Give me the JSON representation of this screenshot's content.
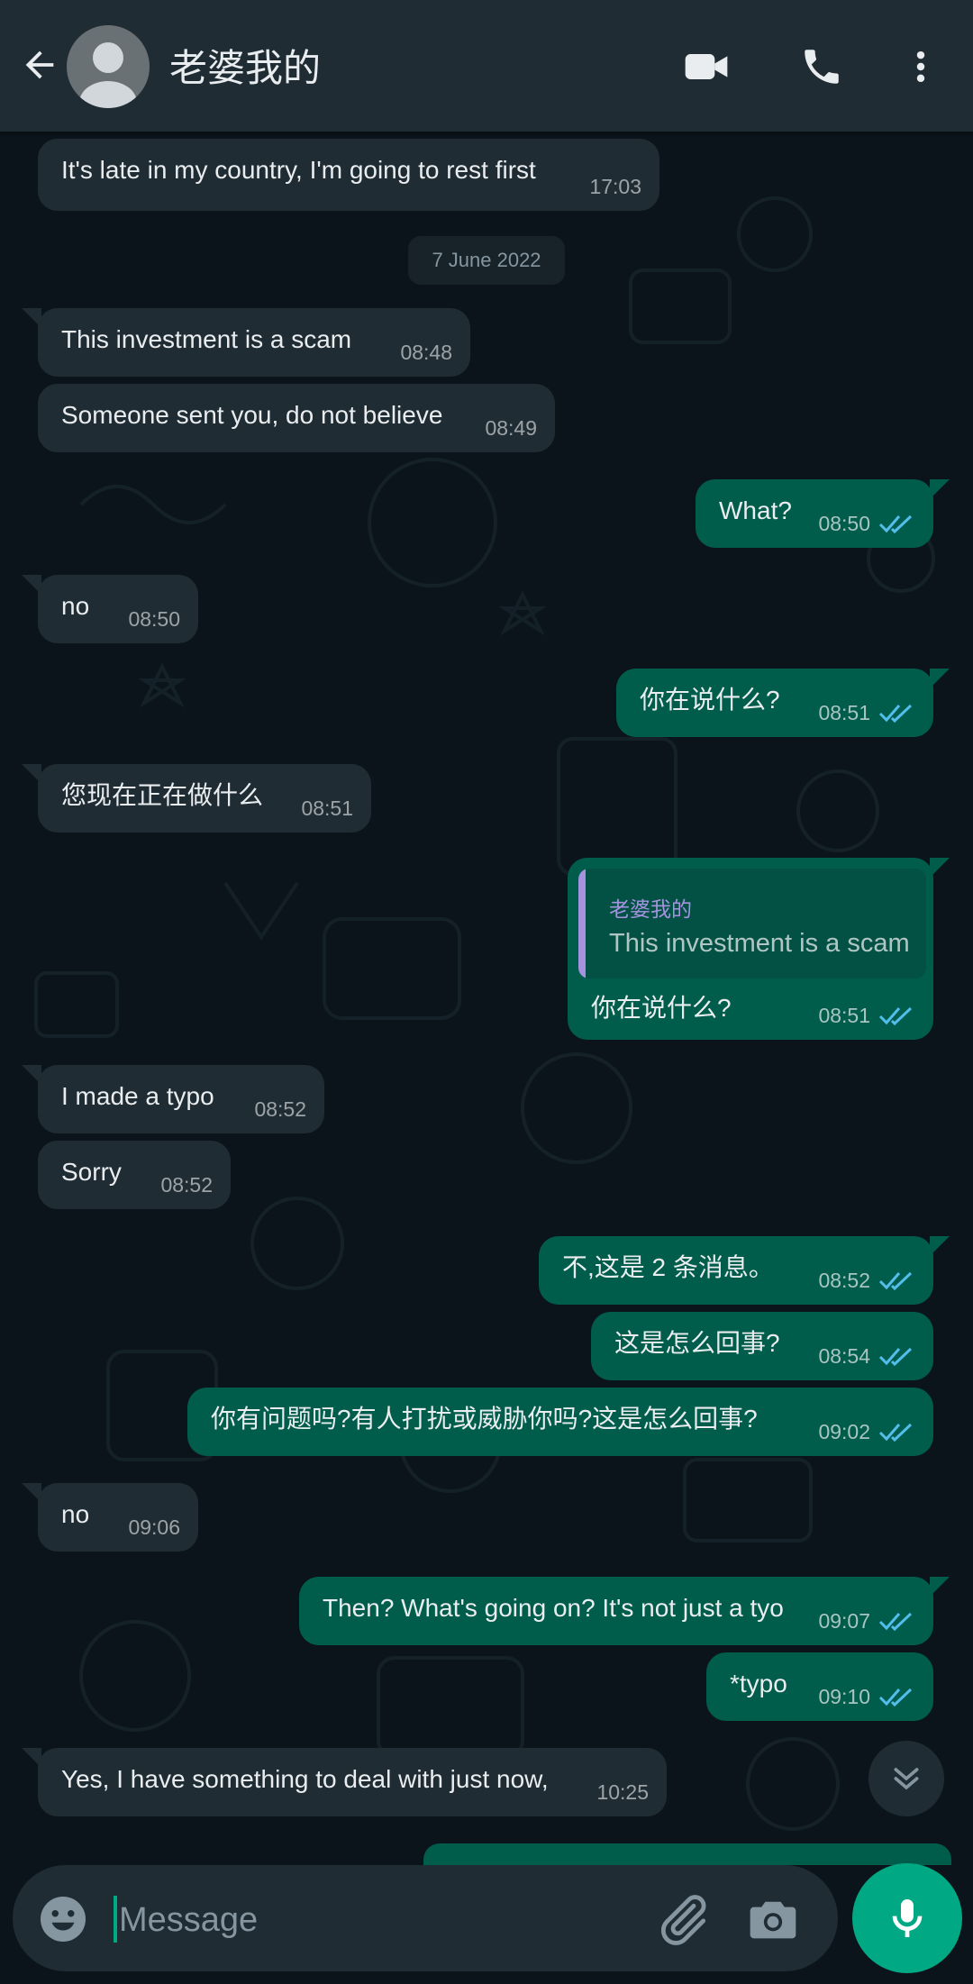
{
  "header": {
    "contact_name": "老婆我的"
  },
  "date_chip": "7 June 2022",
  "messages": [
    {
      "dir": "in",
      "text": "It's late in my country, I'm going to rest first",
      "time": "17:03"
    },
    {
      "dir": "in",
      "text": "This investment is a scam",
      "time": "08:48"
    },
    {
      "dir": "in",
      "text": "Someone sent you, do not believe",
      "time": "08:49"
    },
    {
      "dir": "out",
      "text": "What?",
      "time": "08:50"
    },
    {
      "dir": "in",
      "text": "no",
      "time": "08:50"
    },
    {
      "dir": "out",
      "text": "你在说什么?",
      "time": "08:51"
    },
    {
      "dir": "in",
      "text": "您现在正在做什么",
      "time": "08:51"
    },
    {
      "dir": "out",
      "text": "你在说什么?",
      "time": "08:51",
      "quote": {
        "author": "老婆我的",
        "text": "This investment is a scam"
      }
    },
    {
      "dir": "in",
      "text": "I made a typo",
      "time": "08:52"
    },
    {
      "dir": "in",
      "text": "Sorry",
      "time": "08:52"
    },
    {
      "dir": "out",
      "text": "不,这是 2 条消息。",
      "time": "08:52"
    },
    {
      "dir": "out",
      "text": "这是怎么回事?",
      "time": "08:54"
    },
    {
      "dir": "out",
      "text": "你有问题吗?有人打扰或威胁你吗?这是怎么回事?",
      "time": "09:02"
    },
    {
      "dir": "in",
      "text": "no",
      "time": "09:06"
    },
    {
      "dir": "out",
      "text": "Then? What's going on? It's not just a tyo",
      "time": "09:07"
    },
    {
      "dir": "out",
      "text": "*typo",
      "time": "09:10"
    },
    {
      "dir": "in",
      "text": "Yes, I have something to deal with just now,",
      "time": "10:25"
    }
  ],
  "input": {
    "placeholder": "Message"
  },
  "colors": {
    "background": "#0b141a",
    "header": "#1f2c34",
    "incoming_bubble": "#202c33",
    "outgoing_bubble": "#005c4b",
    "accent": "#00a884",
    "read_ticks": "#53bdeb",
    "quote_author": "#a593e0"
  },
  "icons": [
    "back-arrow-icon",
    "avatar-icon",
    "video-call-icon",
    "phone-call-icon",
    "more-options-icon",
    "double-check-icon",
    "emoji-icon",
    "attach-icon",
    "camera-icon",
    "microphone-icon",
    "scroll-down-icon"
  ]
}
